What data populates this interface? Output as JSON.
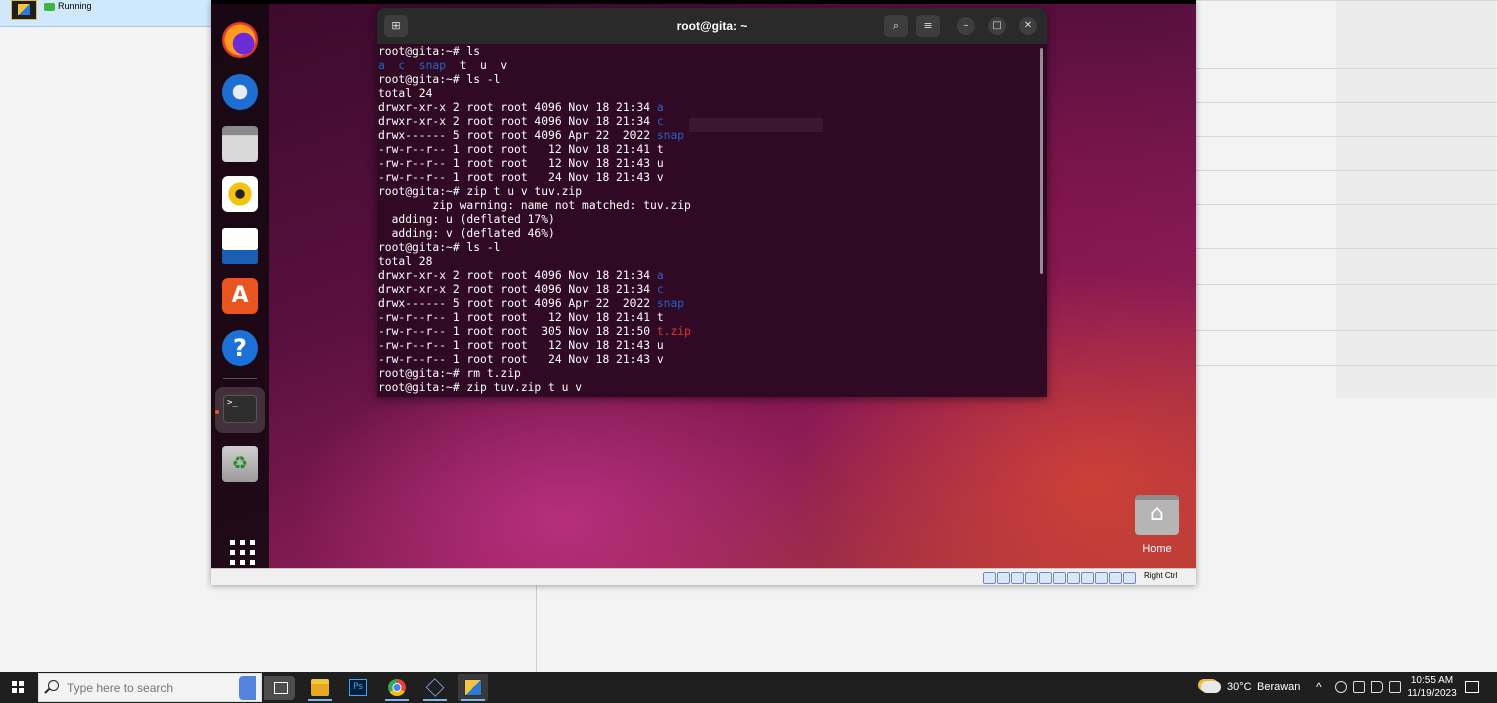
{
  "host": {
    "vm_status": "Running",
    "vm_icon": "virtualbox-vm-icon"
  },
  "terminal": {
    "title": "root@gita: ~",
    "lines": [
      [
        {
          "t": "root@gita:~# ls"
        }
      ],
      [
        {
          "t": "a  c  snap",
          "c": "dir"
        },
        {
          "t": "  t  u  v"
        }
      ],
      [
        {
          "t": "root@gita:~# ls -l"
        }
      ],
      [
        {
          "t": "total 24"
        }
      ],
      [
        {
          "t": "drwxr-xr-x 2 root root 4096 Nov 18 21:34 "
        },
        {
          "t": "a",
          "c": "dir"
        }
      ],
      [
        {
          "t": "drwxr-xr-x 2 root root 4096 Nov 18 21:34 "
        },
        {
          "t": "c",
          "c": "dir"
        }
      ],
      [
        {
          "t": "drwx------ 5 root root 4096 Apr 22  2022 "
        },
        {
          "t": "snap",
          "c": "dir"
        }
      ],
      [
        {
          "t": "-rw-r--r-- 1 root root   12 Nov 18 21:41 t"
        }
      ],
      [
        {
          "t": "-rw-r--r-- 1 root root   12 Nov 18 21:43 u"
        }
      ],
      [
        {
          "t": "-rw-r--r-- 1 root root   24 Nov 18 21:43 v"
        }
      ],
      [
        {
          "t": "root@gita:~# zip t u v tuv.zip"
        }
      ],
      [
        {
          "t": "        zip warning: name not matched: tuv.zip"
        }
      ],
      [
        {
          "t": "  adding: u (deflated 17%)"
        }
      ],
      [
        {
          "t": "  adding: v (deflated 46%)"
        }
      ],
      [
        {
          "t": "root@gita:~# ls -l"
        }
      ],
      [
        {
          "t": "total 28"
        }
      ],
      [
        {
          "t": "drwxr-xr-x 2 root root 4096 Nov 18 21:34 "
        },
        {
          "t": "a",
          "c": "dir"
        }
      ],
      [
        {
          "t": "drwxr-xr-x 2 root root 4096 Nov 18 21:34 "
        },
        {
          "t": "c",
          "c": "dir"
        }
      ],
      [
        {
          "t": "drwx------ 5 root root 4096 Apr 22  2022 "
        },
        {
          "t": "snap",
          "c": "dir"
        }
      ],
      [
        {
          "t": "-rw-r--r-- 1 root root   12 Nov 18 21:41 t"
        }
      ],
      [
        {
          "t": "-rw-r--r-- 1 root root  305 Nov 18 21:50 "
        },
        {
          "t": "t.zip",
          "c": "zipf"
        }
      ],
      [
        {
          "t": "-rw-r--r-- 1 root root   12 Nov 18 21:43 u"
        }
      ],
      [
        {
          "t": "-rw-r--r-- 1 root root   24 Nov 18 21:43 v"
        }
      ],
      [
        {
          "t": "root@gita:~# rm t.zip"
        }
      ],
      [
        {
          "t": "root@gita:~# zip tuv.zip t u v"
        }
      ]
    ],
    "colors": {
      "background": "#300a24",
      "directory": "#2a62c9",
      "archive": "#e63434"
    }
  },
  "dock": {
    "items": [
      {
        "name": "firefox-icon"
      },
      {
        "name": "thunderbird-icon"
      },
      {
        "name": "files-icon"
      },
      {
        "name": "rhythmbox-icon"
      },
      {
        "name": "libreoffice-writer-icon"
      },
      {
        "name": "app-center-icon"
      },
      {
        "name": "help-icon"
      },
      {
        "name": "terminal-icon"
      },
      {
        "name": "trash-icon"
      },
      {
        "name": "show-apps-icon"
      }
    ]
  },
  "desktop": {
    "home_label": "Home"
  },
  "vm_statusbar": {
    "host_key": "Right Ctrl"
  },
  "taskbar": {
    "search_placeholder": "Type here to search",
    "weather_temp": "30°C",
    "weather_text": "Berawan",
    "time": "10:55 AM",
    "date": "11/19/2023"
  }
}
